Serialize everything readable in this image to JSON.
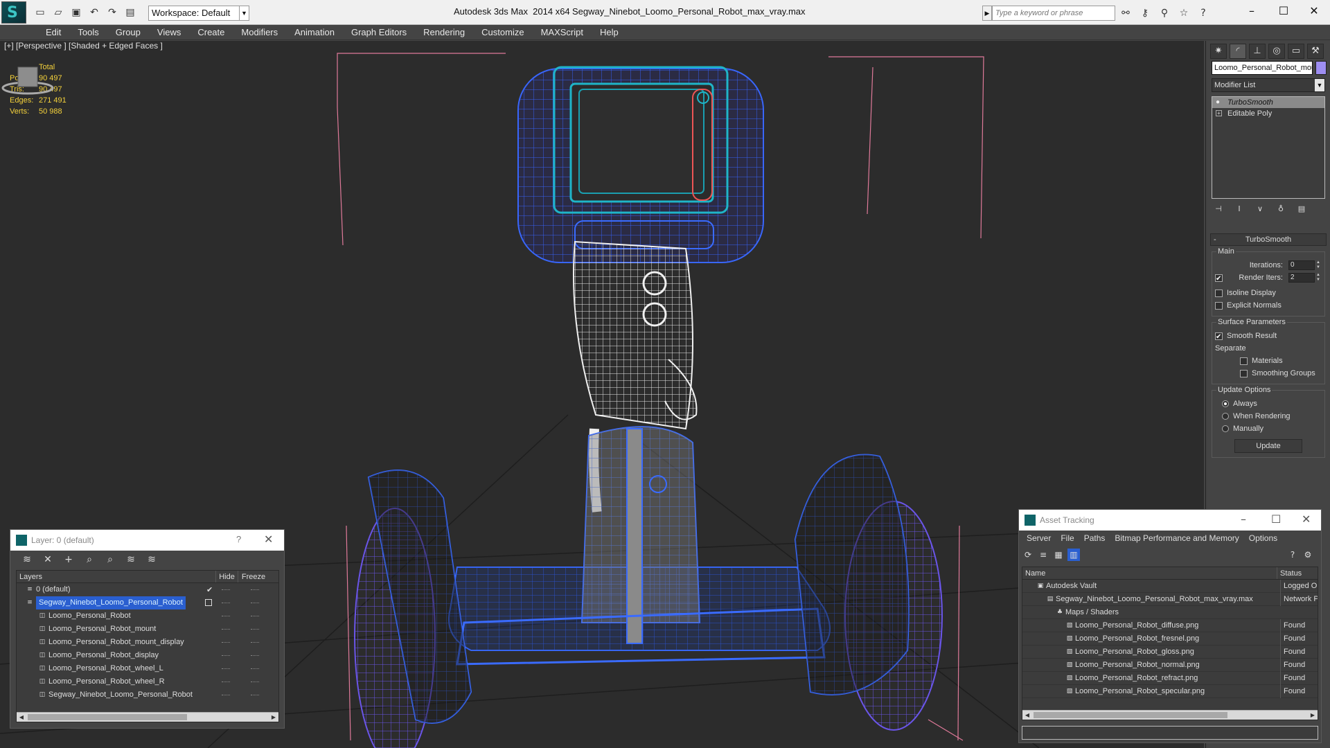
{
  "titlebar": {
    "workspace": "Workspace: Default",
    "app_title": "Autodesk 3ds Max  2014 x64",
    "file_title": "Segway_Ninebot_Loomo_Personal_Robot_max_vray.max",
    "search_placeholder": "Type a keyword or phrase"
  },
  "menu": [
    "Edit",
    "Tools",
    "Group",
    "Views",
    "Create",
    "Modifiers",
    "Animation",
    "Graph Editors",
    "Rendering",
    "Customize",
    "MAXScript",
    "Help"
  ],
  "viewport": {
    "label": "[+] [Perspective ] [Shaded + Edged Faces ]",
    "stats": {
      "header": "Total",
      "rows": [
        {
          "label": "Polys:",
          "value": "90 497"
        },
        {
          "label": "Tris:",
          "value": "90 497"
        },
        {
          "label": "Edges:",
          "value": "271 491"
        },
        {
          "label": "Verts:",
          "value": "50 988"
        }
      ]
    }
  },
  "command_panel": {
    "object_name": "Loomo_Personal_Robot_mount",
    "object_color": "#9e8ef2",
    "modifier_list": "Modifier List",
    "stack": [
      "TurboSmooth",
      "Editable Poly"
    ],
    "rollout": {
      "title": "TurboSmooth",
      "main": {
        "title": "Main",
        "iterations_label": "Iterations:",
        "iterations_value": "0",
        "render_iters_label": "Render Iters:",
        "render_iters_value": "2",
        "isoline": "Isoline Display",
        "explicit": "Explicit Normals"
      },
      "surface": {
        "title": "Surface Parameters",
        "smooth_result": "Smooth Result",
        "separate": "Separate",
        "materials": "Materials",
        "smoothing_groups": "Smoothing Groups"
      },
      "update": {
        "title": "Update Options",
        "always": "Always",
        "when_rendering": "When Rendering",
        "manually": "Manually",
        "button": "Update"
      }
    }
  },
  "layer_window": {
    "title": "Layer: 0 (default)",
    "help": "?",
    "columns": {
      "layers": "Layers",
      "hide": "Hide",
      "freeze": "Freeze"
    },
    "rows": [
      {
        "name": "0 (default)",
        "level": 0
      },
      {
        "name": "Segway_Ninebot_Loomo_Personal_Robot",
        "level": 0,
        "selected": true
      },
      {
        "name": "Loomo_Personal_Robot",
        "level": 1
      },
      {
        "name": "Loomo_Personal_Robot_mount",
        "level": 1
      },
      {
        "name": "Loomo_Personal_Robot_mount_display",
        "level": 1
      },
      {
        "name": "Loomo_Personal_Robot_display",
        "level": 1
      },
      {
        "name": "Loomo_Personal_Robot_wheel_L",
        "level": 1
      },
      {
        "name": "Loomo_Personal_Robot_wheel_R",
        "level": 1
      },
      {
        "name": "Segway_Ninebot_Loomo_Personal_Robot",
        "level": 1
      }
    ]
  },
  "asset_window": {
    "title": "Asset Tracking",
    "menu": [
      "Server",
      "File",
      "Paths",
      "Bitmap Performance and Memory",
      "Options"
    ],
    "columns": {
      "name": "Name",
      "status": "Status"
    },
    "rows": [
      {
        "name": "Autodesk Vault",
        "status": "Logged Ou",
        "level": 0
      },
      {
        "name": "Segway_Ninebot_Loomo_Personal_Robot_max_vray.max",
        "status": "Network P",
        "level": 1
      },
      {
        "name": "Maps / Shaders",
        "status": "",
        "level": 2
      },
      {
        "name": "Loomo_Personal_Robot_diffuse.png",
        "status": "Found",
        "level": 3
      },
      {
        "name": "Loomo_Personal_Robot_fresnel.png",
        "status": "Found",
        "level": 3
      },
      {
        "name": "Loomo_Personal_Robot_gloss.png",
        "status": "Found",
        "level": 3
      },
      {
        "name": "Loomo_Personal_Robot_normal.png",
        "status": "Found",
        "level": 3
      },
      {
        "name": "Loomo_Personal_Robot_refract.png",
        "status": "Found",
        "level": 3
      },
      {
        "name": "Loomo_Personal_Robot_specular.png",
        "status": "Found",
        "level": 3
      }
    ]
  },
  "colors": {
    "selection": "#2a5fd0",
    "stats_text": "#f5d23b",
    "wire_blue": "#3a6bff",
    "wire_violet": "#6a55e8",
    "wire_cyan": "#1fb5c8",
    "bounding_pink": "#e07a9a"
  }
}
